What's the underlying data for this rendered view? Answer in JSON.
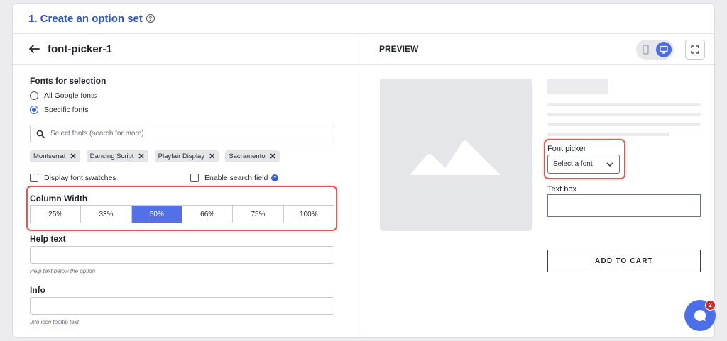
{
  "card": {
    "title": "1. Create an option set"
  },
  "editor": {
    "field_name": "font-picker-1",
    "fonts_section_label": "Fonts for selection",
    "radio_options": [
      {
        "label": "All Google fonts",
        "checked": false
      },
      {
        "label": "Specific fonts",
        "checked": true
      }
    ],
    "search_placeholder": "Select fonts (search for more)",
    "selected_fonts": [
      "Montserrat",
      "Dancing Script",
      "Playfair Display",
      "Sacramento"
    ],
    "chip_remove_glyph": "✕",
    "display_swatches_label": "Display font swatches",
    "enable_search_label": "Enable search field",
    "column_width_label": "Column Width",
    "column_widths": [
      "25%",
      "33%",
      "50%",
      "66%",
      "75%",
      "100%"
    ],
    "column_width_selected": "50%",
    "help_text_label": "Help text",
    "help_text_hint": "Help text below the option",
    "info_label": "Info",
    "info_hint": "Info icon tooltip text"
  },
  "preview": {
    "label": "PREVIEW",
    "font_picker_label": "Font picker",
    "font_select_value": "Select a font",
    "text_box_label": "Text box",
    "add_to_cart_label": "ADD TO CART"
  },
  "chat": {
    "badge_count": "2"
  },
  "colors": {
    "accent": "#5470e8",
    "highlight": "#d65c55",
    "title": "#2f55c8"
  }
}
